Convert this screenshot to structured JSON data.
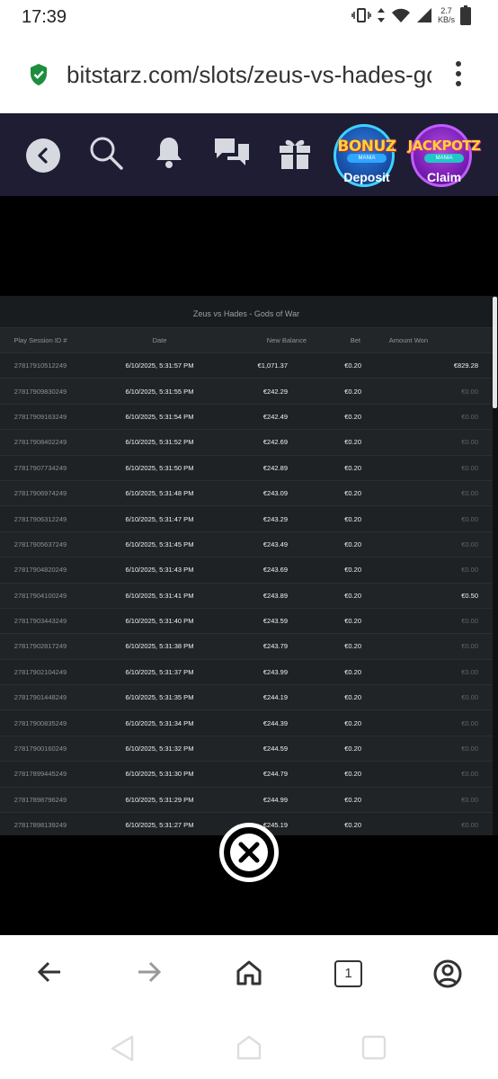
{
  "status_bar": {
    "time": "17:39",
    "speed_value": "2.7",
    "speed_unit": "KB/s"
  },
  "browser": {
    "url": "bitstarz.com/slots/zeus-vs-hades-gods-of-war",
    "tab_count": "1"
  },
  "casino_nav": {
    "promos": [
      {
        "title": "BONUZ",
        "subtitle": "MANIA",
        "action": "Deposit",
        "icon": "bonuz-mania-badge"
      },
      {
        "title": "JACKPOTZ",
        "subtitle": "MANIA",
        "action": "Claim",
        "icon": "jackpotz-mania-badge"
      }
    ]
  },
  "history": {
    "title": "Zeus vs Hades - Gods of War",
    "columns": [
      "Play Session ID #",
      "Date",
      "New Balance",
      "Bet",
      "Amount Won"
    ],
    "rows": [
      {
        "id": "27817910512249",
        "date": "6/10/2025, 5:31:57 PM",
        "balance": "€1,071.37",
        "bet": "€0.20",
        "won": "€829.28",
        "win": true
      },
      {
        "id": "27817909830249",
        "date": "6/10/2025, 5:31:55 PM",
        "balance": "€242.29",
        "bet": "€0.20",
        "won": "€0.00",
        "win": false
      },
      {
        "id": "27817909163249",
        "date": "6/10/2025, 5:31:54 PM",
        "balance": "€242.49",
        "bet": "€0.20",
        "won": "€0.00",
        "win": false
      },
      {
        "id": "27817908402249",
        "date": "6/10/2025, 5:31:52 PM",
        "balance": "€242.69",
        "bet": "€0.20",
        "won": "€0.00",
        "win": false
      },
      {
        "id": "27817907734249",
        "date": "6/10/2025, 5:31:50 PM",
        "balance": "€242.89",
        "bet": "€0.20",
        "won": "€0.00",
        "win": false
      },
      {
        "id": "27817906974249",
        "date": "6/10/2025, 5:31:48 PM",
        "balance": "€243.09",
        "bet": "€0.20",
        "won": "€0.00",
        "win": false
      },
      {
        "id": "27817906312249",
        "date": "6/10/2025, 5:31:47 PM",
        "balance": "€243.29",
        "bet": "€0.20",
        "won": "€0.00",
        "win": false
      },
      {
        "id": "27817905637249",
        "date": "6/10/2025, 5:31:45 PM",
        "balance": "€243.49",
        "bet": "€0.20",
        "won": "€0.00",
        "win": false
      },
      {
        "id": "27817904820249",
        "date": "6/10/2025, 5:31:43 PM",
        "balance": "€243.69",
        "bet": "€0.20",
        "won": "€0.00",
        "win": false
      },
      {
        "id": "27817904100249",
        "date": "6/10/2025, 5:31:41 PM",
        "balance": "€243.89",
        "bet": "€0.20",
        "won": "€0.50",
        "win": true
      },
      {
        "id": "27817903443249",
        "date": "6/10/2025, 5:31:40 PM",
        "balance": "€243.59",
        "bet": "€0.20",
        "won": "€0.00",
        "win": false
      },
      {
        "id": "27817902817249",
        "date": "6/10/2025, 5:31:38 PM",
        "balance": "€243.79",
        "bet": "€0.20",
        "won": "€0.00",
        "win": false
      },
      {
        "id": "27817902104249",
        "date": "6/10/2025, 5:31:37 PM",
        "balance": "€243.99",
        "bet": "€0.20",
        "won": "€0.00",
        "win": false
      },
      {
        "id": "27817901448249",
        "date": "6/10/2025, 5:31:35 PM",
        "balance": "€244.19",
        "bet": "€0.20",
        "won": "€0.00",
        "win": false
      },
      {
        "id": "27817900835249",
        "date": "6/10/2025, 5:31:34 PM",
        "balance": "€244.39",
        "bet": "€0.20",
        "won": "€0.00",
        "win": false
      },
      {
        "id": "27817900160249",
        "date": "6/10/2025, 5:31:32 PM",
        "balance": "€244.59",
        "bet": "€0.20",
        "won": "€0.00",
        "win": false
      },
      {
        "id": "27817899445249",
        "date": "6/10/2025, 5:31:30 PM",
        "balance": "€244.79",
        "bet": "€0.20",
        "won": "€0.00",
        "win": false
      },
      {
        "id": "27817898796249",
        "date": "6/10/2025, 5:31:29 PM",
        "balance": "€244.99",
        "bet": "€0.20",
        "won": "€0.00",
        "win": false
      },
      {
        "id": "27817898139249",
        "date": "6/10/2025, 5:31:27 PM",
        "balance": "€245.19",
        "bet": "€0.20",
        "won": "€0.00",
        "win": false
      }
    ]
  },
  "colors": {
    "nav_bg": "#1e1d33",
    "panel_bg": "#1c1f22",
    "secure_lock": "#1e8e3e"
  }
}
